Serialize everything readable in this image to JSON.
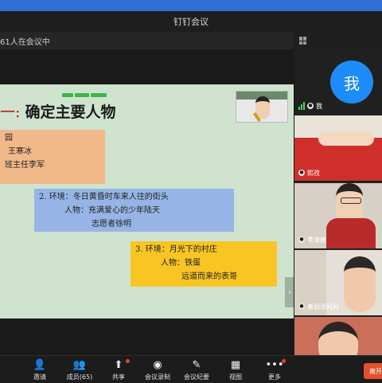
{
  "window": {
    "title": "钉钉会议"
  },
  "meeting": {
    "participants_label": "61人在会议中"
  },
  "slide": {
    "heading_prefix": "一:",
    "heading": "确定主要人物",
    "box1": {
      "line1": "园",
      "line2": "王寒冰",
      "line3": "班主任李军"
    },
    "box2": {
      "line1": "2.    环境：冬日黄昏时车来人往的街头",
      "line2": "人物：充满爱心的少年陆天",
      "line3": "志愿者徐明"
    },
    "box3": {
      "line1": "3.    环境：月光下的村庄",
      "line2": "人物：铁蛋",
      "line3": "远道而来的表哥"
    }
  },
  "participants": [
    {
      "name": "我",
      "avatar_text": "我",
      "avatar_color": "#1e8cf8"
    },
    {
      "name": "熙孜"
    },
    {
      "name": "李清楼"
    },
    {
      "name": "秦润泽妈妈"
    }
  ],
  "toolbar": {
    "invite": "邀请",
    "members": "成员(65)",
    "share": "共享",
    "record": "会议录制",
    "minutes": "会议纪要",
    "view": "视图",
    "more": "更多",
    "end": "离开"
  },
  "colors": {
    "accent": "#1e8cf8",
    "end": "#e5512c",
    "slide_bg": "#cfe3cf"
  }
}
